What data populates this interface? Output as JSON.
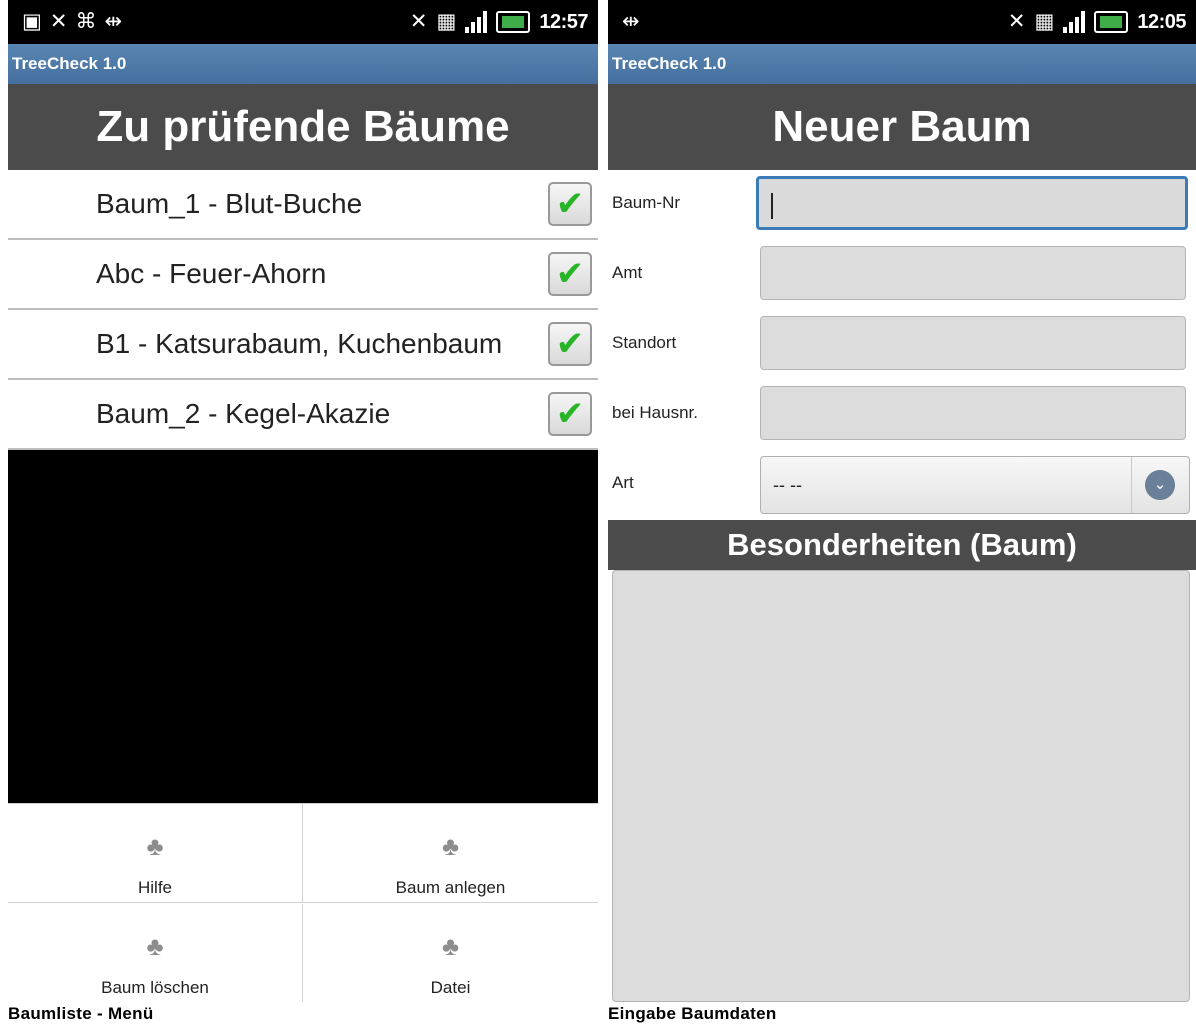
{
  "left_screen": {
    "status": {
      "time": "12:57"
    },
    "app_title": "TreeCheck 1.0",
    "header": "Zu prüfende Bäume",
    "trees": [
      {
        "label": "Baum_1 - Blut-Buche",
        "checked": true
      },
      {
        "label": "Abc - Feuer-Ahorn",
        "checked": true
      },
      {
        "label": "B1 - Katsurabaum, Kuchenbaum",
        "checked": true
      },
      {
        "label": "Baum_2 - Kegel-Akazie",
        "checked": true
      }
    ],
    "menu": [
      {
        "label": "Hilfe",
        "icon": "tree-help-icon"
      },
      {
        "label": "Baum anlegen",
        "icon": "tree-add-icon"
      },
      {
        "label": "Baum löschen",
        "icon": "tree-delete-icon"
      },
      {
        "label": "Datei",
        "icon": "tree-file-icon"
      }
    ],
    "caption": "Baumliste - Menü"
  },
  "right_screen": {
    "status": {
      "time": "12:05"
    },
    "app_title": "TreeCheck 1.0",
    "header": "Neuer Baum",
    "fields": [
      {
        "label": "Baum-Nr",
        "value": ""
      },
      {
        "label": "Amt",
        "value": ""
      },
      {
        "label": "Standort",
        "value": ""
      },
      {
        "label": "bei Hausnr.",
        "value": ""
      }
    ],
    "art": {
      "label": "Art",
      "selected": "-- --"
    },
    "section": "Besonderheiten (Baum)",
    "caption": "Eingabe Baumdaten"
  },
  "colors": {
    "titlebar": "#4f7aa8",
    "header": "#4b4b4b",
    "check": "#27b527",
    "active_border": "#3b7cb8"
  }
}
